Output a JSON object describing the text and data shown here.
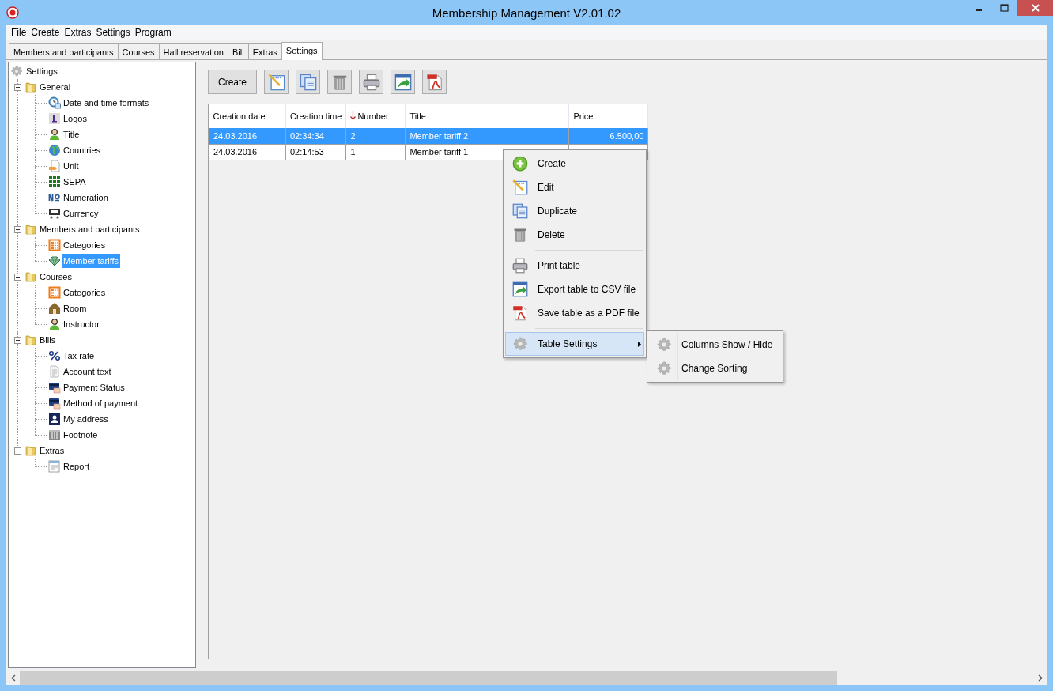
{
  "window": {
    "title": "Membership Management V2.01.02"
  },
  "menubar": [
    "File",
    "Create",
    "Extras",
    "Settings",
    "Program"
  ],
  "tabs": [
    {
      "label": "Members and participants",
      "selected": false
    },
    {
      "label": "Courses",
      "selected": false
    },
    {
      "label": "Hall reservation",
      "selected": false
    },
    {
      "label": "Bill",
      "selected": false
    },
    {
      "label": "Extras",
      "selected": false
    },
    {
      "label": "Settings",
      "selected": true
    }
  ],
  "tree": {
    "label": "Settings",
    "children": [
      {
        "label": "General",
        "expanded": true,
        "children": [
          {
            "label": "Date and time formats",
            "selected": false
          },
          {
            "label": "Logos",
            "selected": false
          },
          {
            "label": "Title",
            "selected": false
          },
          {
            "label": "Countries",
            "selected": false
          },
          {
            "label": "Unit",
            "selected": false
          },
          {
            "label": "SEPA",
            "selected": false
          },
          {
            "label": "Numeration",
            "selected": false
          },
          {
            "label": "Currency",
            "selected": false
          }
        ]
      },
      {
        "label": "Members and participants",
        "expanded": true,
        "children": [
          {
            "label": "Categories",
            "selected": false
          },
          {
            "label": "Member tariffs",
            "selected": true
          }
        ]
      },
      {
        "label": "Courses",
        "expanded": true,
        "children": [
          {
            "label": "Categories",
            "selected": false
          },
          {
            "label": "Room",
            "selected": false
          },
          {
            "label": "Instructor",
            "selected": false
          }
        ]
      },
      {
        "label": "Bills",
        "expanded": true,
        "children": [
          {
            "label": "Tax rate",
            "selected": false
          },
          {
            "label": "Account text",
            "selected": false
          },
          {
            "label": "Payment Status",
            "selected": false
          },
          {
            "label": "Method of payment",
            "selected": false
          },
          {
            "label": "My address",
            "selected": false
          },
          {
            "label": "Footnote",
            "selected": false
          }
        ]
      },
      {
        "label": "Extras",
        "expanded": true,
        "children": [
          {
            "label": "Report",
            "selected": false
          }
        ]
      }
    ]
  },
  "toolbar": [
    {
      "kind": "text",
      "label": "Create"
    },
    {
      "kind": "icon"
    },
    {
      "kind": "icon"
    },
    {
      "kind": "icon"
    },
    {
      "kind": "icon"
    },
    {
      "kind": "icon"
    },
    {
      "kind": "icon"
    }
  ],
  "table": {
    "columns": [
      {
        "label": "Creation date",
        "sorted": false
      },
      {
        "label": "Creation time",
        "sorted": false
      },
      {
        "label": "Number",
        "sorted": true
      },
      {
        "label": "Title",
        "sorted": false
      },
      {
        "label": "Price",
        "sorted": false
      }
    ],
    "rows": [
      {
        "selected": true,
        "cells": [
          "24.03.2016",
          "02:34:34",
          "2",
          "Member tariff 2",
          "6.500,00"
        ]
      },
      {
        "selected": false,
        "cells": [
          "24.03.2016",
          "02:14:53",
          "1",
          "Member tariff 1"
        ]
      }
    ]
  },
  "context_menu": {
    "items": [
      {
        "kind": "item",
        "label": "Create",
        "highlighted": false
      },
      {
        "kind": "item",
        "label": "Edit",
        "highlighted": false
      },
      {
        "kind": "item",
        "label": "Duplicate",
        "highlighted": false
      },
      {
        "kind": "item",
        "label": "Delete",
        "highlighted": false
      },
      {
        "kind": "separator"
      },
      {
        "kind": "item",
        "label": "Print table",
        "highlighted": false
      },
      {
        "kind": "item",
        "label": "Export table to CSV file",
        "highlighted": false
      },
      {
        "kind": "item",
        "label": "Save table as a PDF file",
        "highlighted": false
      },
      {
        "kind": "separator"
      },
      {
        "kind": "item",
        "label": "Table Settings",
        "highlighted": true,
        "submenu": true
      }
    ],
    "submenu": [
      "Columns Show / Hide",
      "Change Sorting"
    ]
  }
}
